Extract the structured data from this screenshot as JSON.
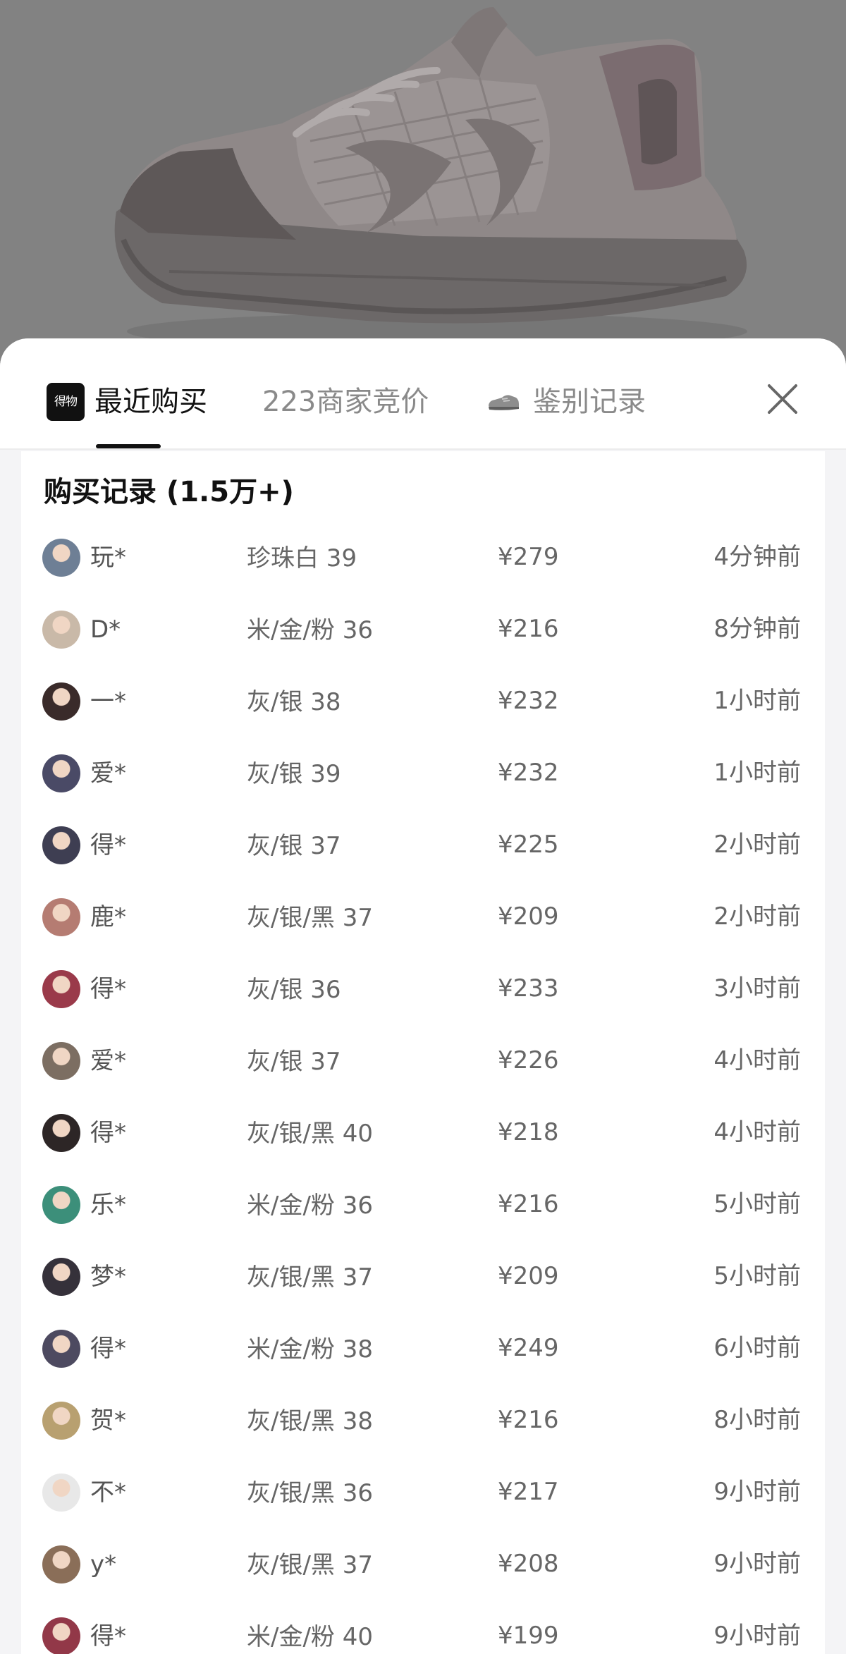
{
  "tabs": [
    {
      "label": "最近购买",
      "logo_text": "得物",
      "active": true
    },
    {
      "label": "223商家竞价",
      "active": false
    },
    {
      "label": "鉴别记录",
      "active": false
    }
  ],
  "close_icon": "close-icon",
  "records": {
    "title": "购买记录 (1.5万+)",
    "rows": [
      {
        "user": "玩*",
        "spec": "珍珠白 39",
        "price": "¥279",
        "time": "4分钟前",
        "avatar": "#6e7f95"
      },
      {
        "user": "D*",
        "spec": "米/金/粉 36",
        "price": "¥216",
        "time": "8分钟前",
        "avatar": "#c9b9a8"
      },
      {
        "user": "一*",
        "spec": "灰/银 38",
        "price": "¥232",
        "time": "1小时前",
        "avatar": "#3a2b2a"
      },
      {
        "user": "爱*",
        "spec": "灰/银 39",
        "price": "¥232",
        "time": "1小时前",
        "avatar": "#4a4a66"
      },
      {
        "user": "得*",
        "spec": "灰/银 37",
        "price": "¥225",
        "time": "2小时前",
        "avatar": "#3e3e52"
      },
      {
        "user": "鹿*",
        "spec": "灰/银/黑 37",
        "price": "¥209",
        "time": "2小时前",
        "avatar": "#b57c72"
      },
      {
        "user": "得*",
        "spec": "灰/银 36",
        "price": "¥233",
        "time": "3小时前",
        "avatar": "#9a3a4a"
      },
      {
        "user": "爱*",
        "spec": "灰/银 37",
        "price": "¥226",
        "time": "4小时前",
        "avatar": "#7c6e62"
      },
      {
        "user": "得*",
        "spec": "灰/银/黑 40",
        "price": "¥218",
        "time": "4小时前",
        "avatar": "#2d2626"
      },
      {
        "user": "乐*",
        "spec": "米/金/粉 36",
        "price": "¥216",
        "time": "5小时前",
        "avatar": "#3c8f7a"
      },
      {
        "user": "梦*",
        "spec": "灰/银/黑 37",
        "price": "¥209",
        "time": "5小时前",
        "avatar": "#35313a"
      },
      {
        "user": "得*",
        "spec": "米/金/粉 38",
        "price": "¥249",
        "time": "6小时前",
        "avatar": "#4d4a60"
      },
      {
        "user": "贺*",
        "spec": "灰/银/黑 38",
        "price": "¥216",
        "time": "8小时前",
        "avatar": "#b8a070"
      },
      {
        "user": "不*",
        "spec": "灰/银/黑 36",
        "price": "¥217",
        "time": "9小时前",
        "avatar": "#e8e8e8"
      },
      {
        "user": "y*",
        "spec": "灰/银/黑 37",
        "price": "¥208",
        "time": "9小时前",
        "avatar": "#8a6e58"
      },
      {
        "user": "得*",
        "spec": "米/金/粉 40",
        "price": "¥199",
        "time": "9小时前",
        "avatar": "#923848"
      }
    ]
  },
  "colors": {
    "active_tab": "#111111",
    "inactive_tab": "#8a8a8a",
    "sheet_bg": "#f4f4f6",
    "card_bg": "#ffffff",
    "overlay": "#828282"
  }
}
